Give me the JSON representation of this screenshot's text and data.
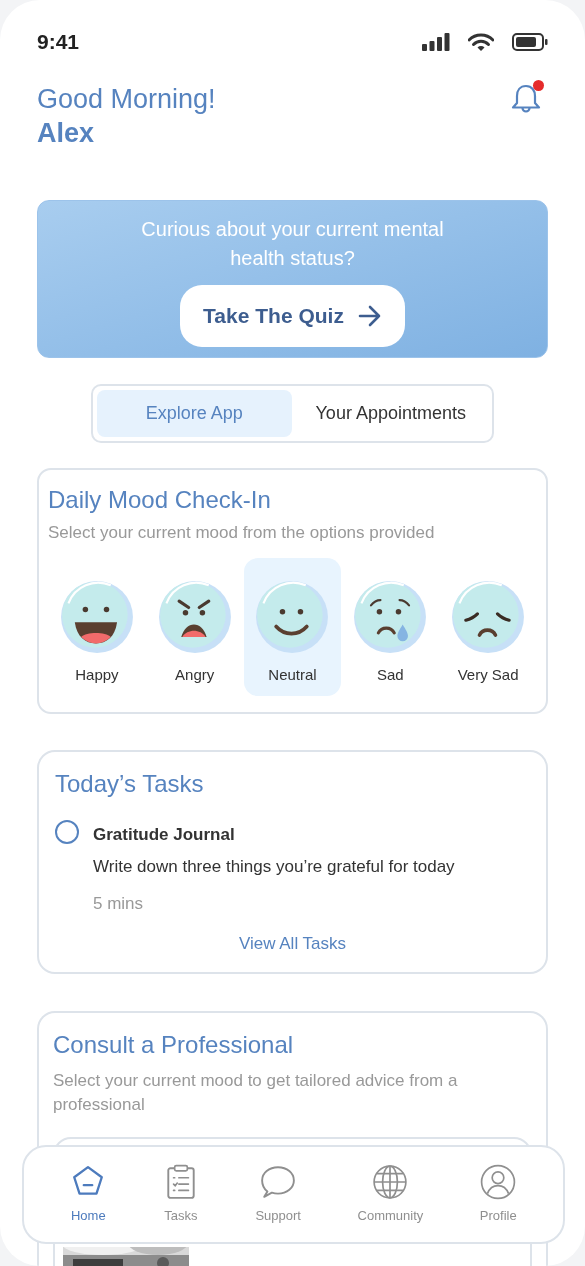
{
  "status_bar": {
    "time": "9:41"
  },
  "header": {
    "greeting": "Good Morning!",
    "name": "Alex",
    "notification": true
  },
  "banner": {
    "text": "Curious about your current mental health status?",
    "button": "Take The Quiz"
  },
  "tabs": [
    {
      "label": "Explore App",
      "selected": true
    },
    {
      "label": "Your Appointments",
      "selected": false
    }
  ],
  "mood_card": {
    "title": "Daily Mood Check-In",
    "subtitle": "Select your current mood from the options provided",
    "moods": [
      {
        "kind": "happy",
        "label": "Happy",
        "selected": false
      },
      {
        "kind": "angry",
        "label": "Angry",
        "selected": false
      },
      {
        "kind": "neutral",
        "label": "Neutral",
        "selected": true
      },
      {
        "kind": "sad",
        "label": "Sad",
        "selected": false
      },
      {
        "kind": "very_sad",
        "label": "Very Sad",
        "selected": false
      }
    ]
  },
  "tasks_card": {
    "title": "Today’s Tasks",
    "tasks": [
      {
        "title": "Gratitude Journal",
        "description": "Write down three things you’re grateful for today",
        "duration": "5 mins",
        "checked": false
      }
    ],
    "link": "View All Tasks"
  },
  "consult_card": {
    "title": "Consult a Professional",
    "subtitle": "Select your current mood to get tailored advice from a professional"
  },
  "nav": [
    {
      "label": "Home",
      "kind": "home",
      "selected": true
    },
    {
      "label": "Tasks",
      "kind": "tasks",
      "selected": false
    },
    {
      "label": "Support",
      "kind": "support",
      "selected": false
    },
    {
      "label": "Community",
      "kind": "community",
      "selected": false
    },
    {
      "label": "Profile",
      "kind": "profile",
      "selected": false
    }
  ]
}
